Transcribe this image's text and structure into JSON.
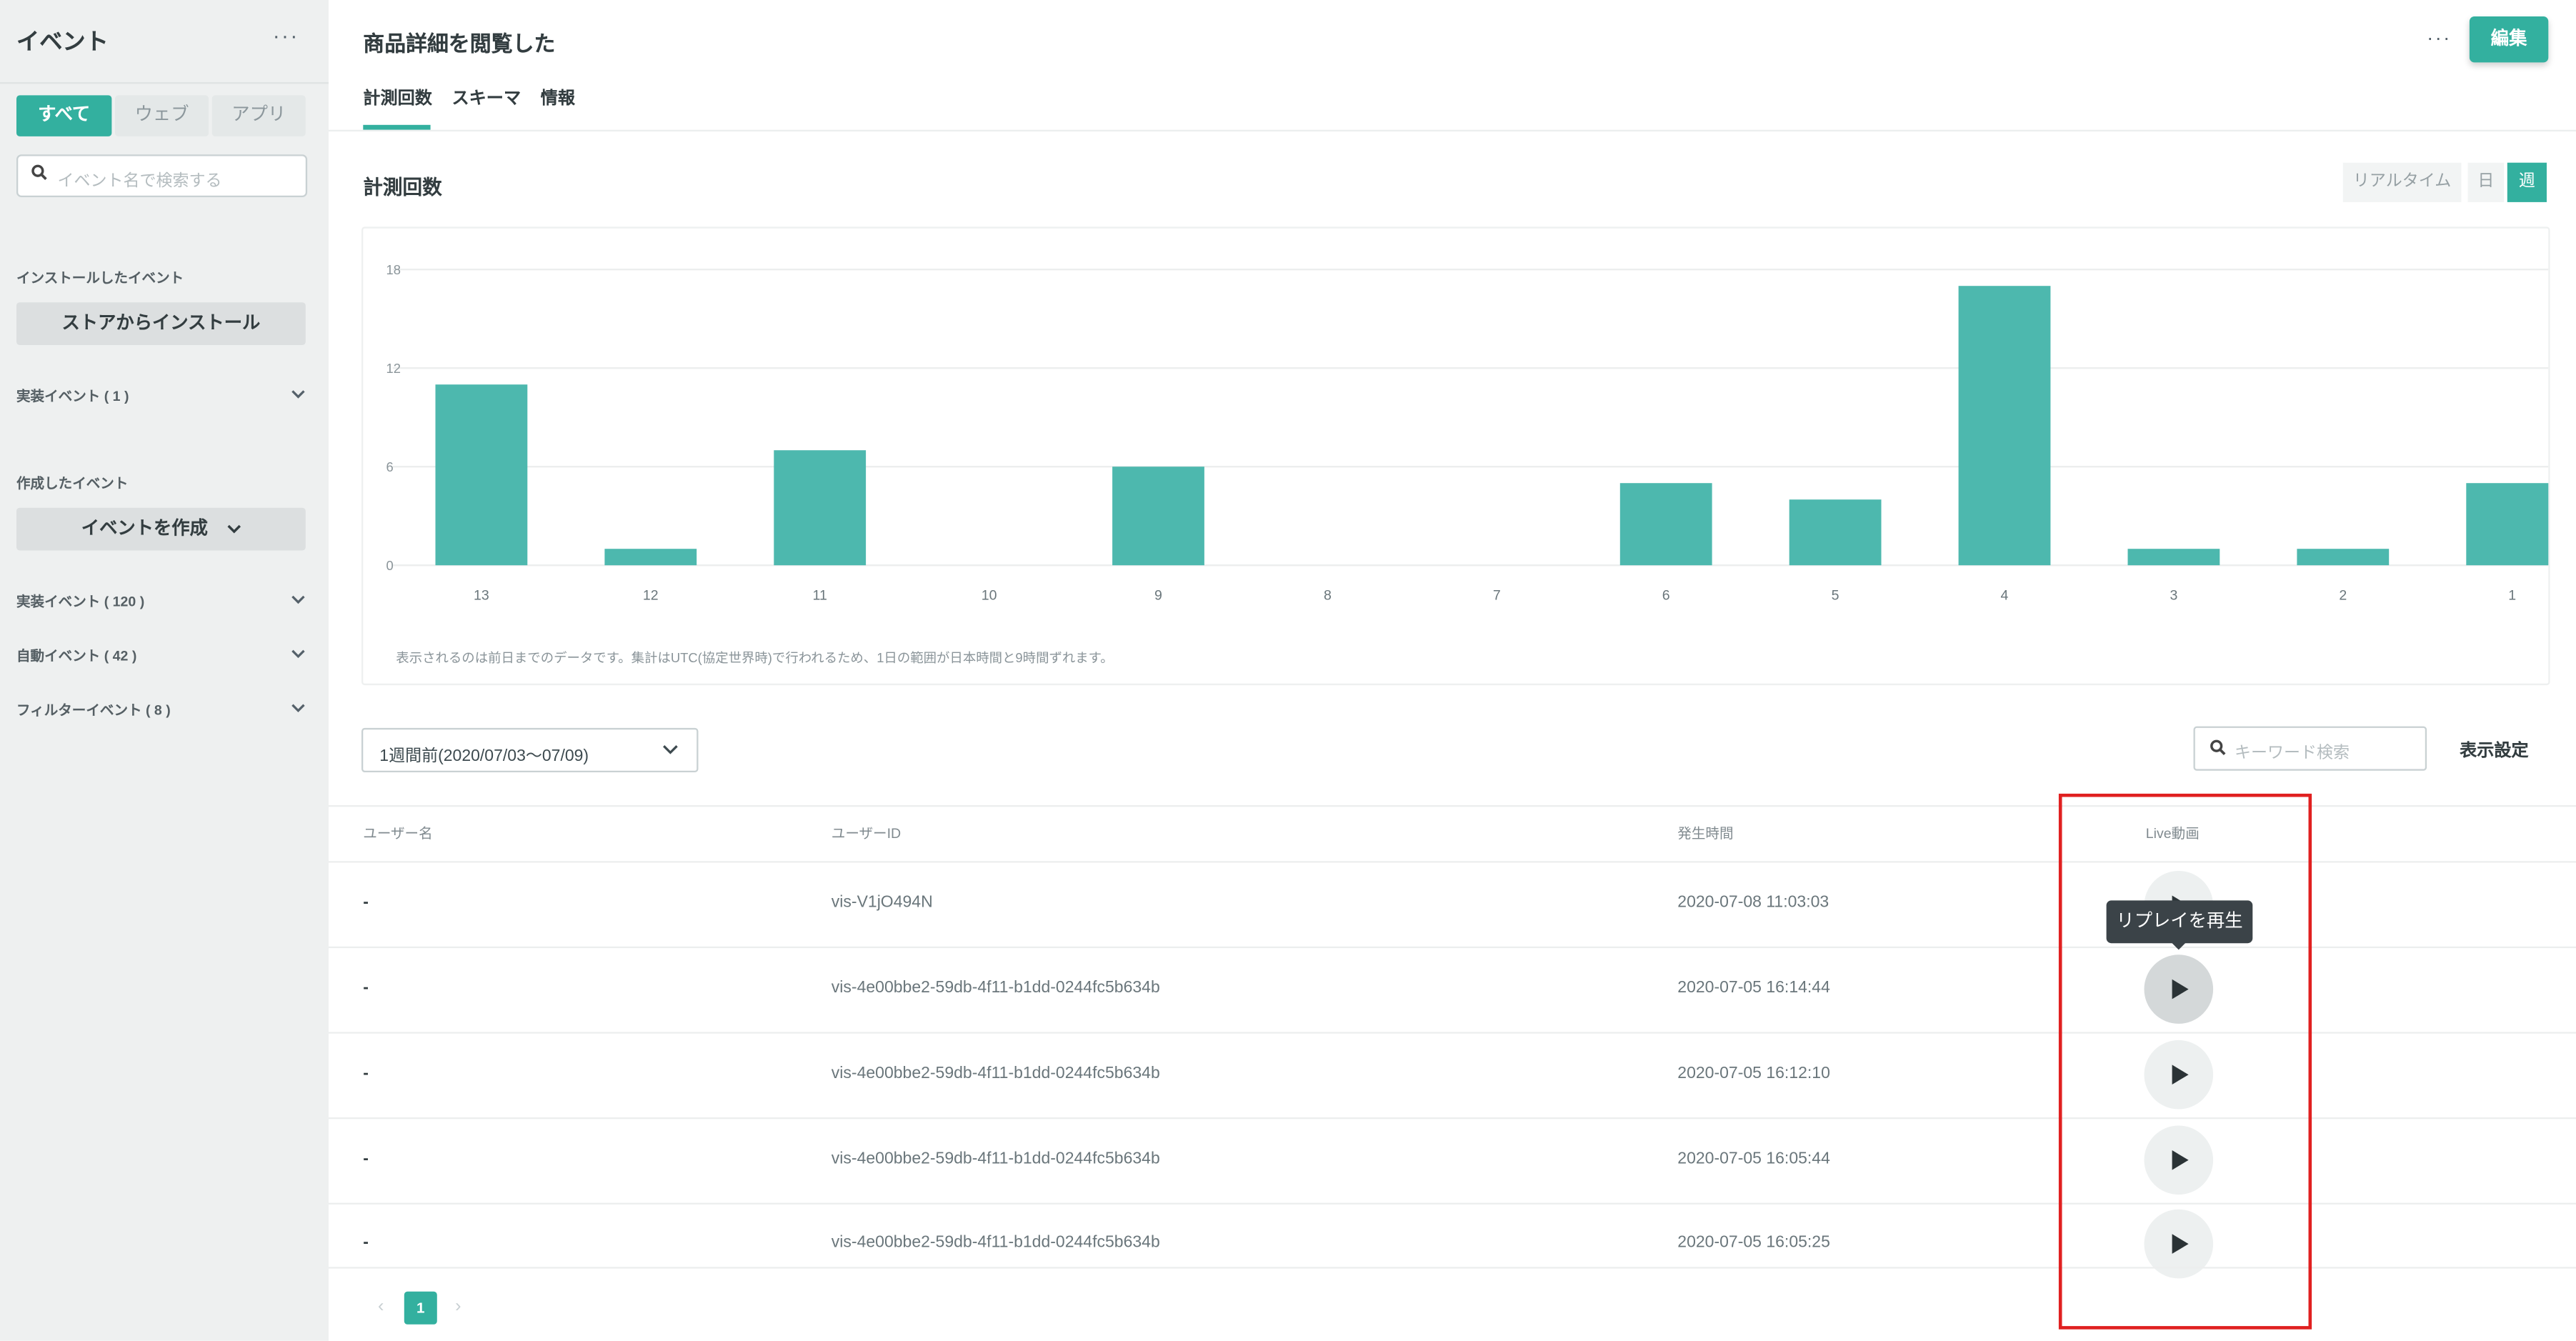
{
  "sidebar": {
    "title": "イベント",
    "more": "···",
    "segments": [
      "すべて",
      "ウェブ",
      "アプリ"
    ],
    "search_placeholder": "イベント名で検索する",
    "installed_label": "インストールしたイベント",
    "store_button": "ストアからインストール",
    "impl_installed": "実装イベント ( 1 )",
    "created_label": "作成したイベント",
    "create_button": "イベントを作成",
    "impl_created": "実装イベント ( 120 )",
    "auto_events": "自動イベント ( 42 )",
    "filter_events": "フィルターイベント ( 8 )"
  },
  "header": {
    "title": "商品詳細を閲覧した",
    "more": "···",
    "edit": "編集",
    "tabs": [
      "計測回数",
      "スキーマ",
      "情報"
    ]
  },
  "section": {
    "title": "計測回数",
    "ranges": [
      "リアルタイム",
      "日",
      "週"
    ],
    "active_range": "週"
  },
  "chart_data": {
    "type": "bar",
    "categories": [
      "13",
      "12",
      "11",
      "10",
      "9",
      "8",
      "7",
      "6",
      "5",
      "4",
      "3",
      "2",
      "1"
    ],
    "values": [
      11,
      1,
      7,
      0,
      6,
      0,
      0,
      5,
      4,
      17,
      1,
      1,
      5
    ],
    "ylim": [
      0,
      18
    ],
    "yticks": [
      0,
      6,
      12,
      18
    ],
    "grid": true,
    "color": "#4db8ae",
    "note": "表示されるのは前日までのデータです。集計はUTC(協定世界時)で行われるため、1日の範囲が日本時間と9時間ずれます。"
  },
  "filters": {
    "period": "1週間前(2020/07/03〜07/09)",
    "keyword_placeholder": "キーワード検索",
    "display_settings": "表示設定"
  },
  "table": {
    "headers": [
      "ユーザー名",
      "ユーザーID",
      "発生時間",
      "Live動画"
    ],
    "rows": [
      {
        "user": "-",
        "id": "vis-V1jO494N",
        "time": "2020-07-08 11:03:03"
      },
      {
        "user": "-",
        "id": "vis-4e00bbe2-59db-4f11-b1dd-0244fc5b634b",
        "time": "2020-07-05 16:14:44"
      },
      {
        "user": "-",
        "id": "vis-4e00bbe2-59db-4f11-b1dd-0244fc5b634b",
        "time": "2020-07-05 16:12:10"
      },
      {
        "user": "-",
        "id": "vis-4e00bbe2-59db-4f11-b1dd-0244fc5b634b",
        "time": "2020-07-05 16:05:44"
      },
      {
        "user": "-",
        "id": "vis-4e00bbe2-59db-4f11-b1dd-0244fc5b634b",
        "time": "2020-07-05 16:05:25"
      }
    ],
    "tooltip": "リプレイを再生"
  },
  "pagination": {
    "prev": "‹",
    "current": "1",
    "next": "›"
  },
  "colors": {
    "accent": "#33b09f",
    "highlight": "#e02020"
  }
}
